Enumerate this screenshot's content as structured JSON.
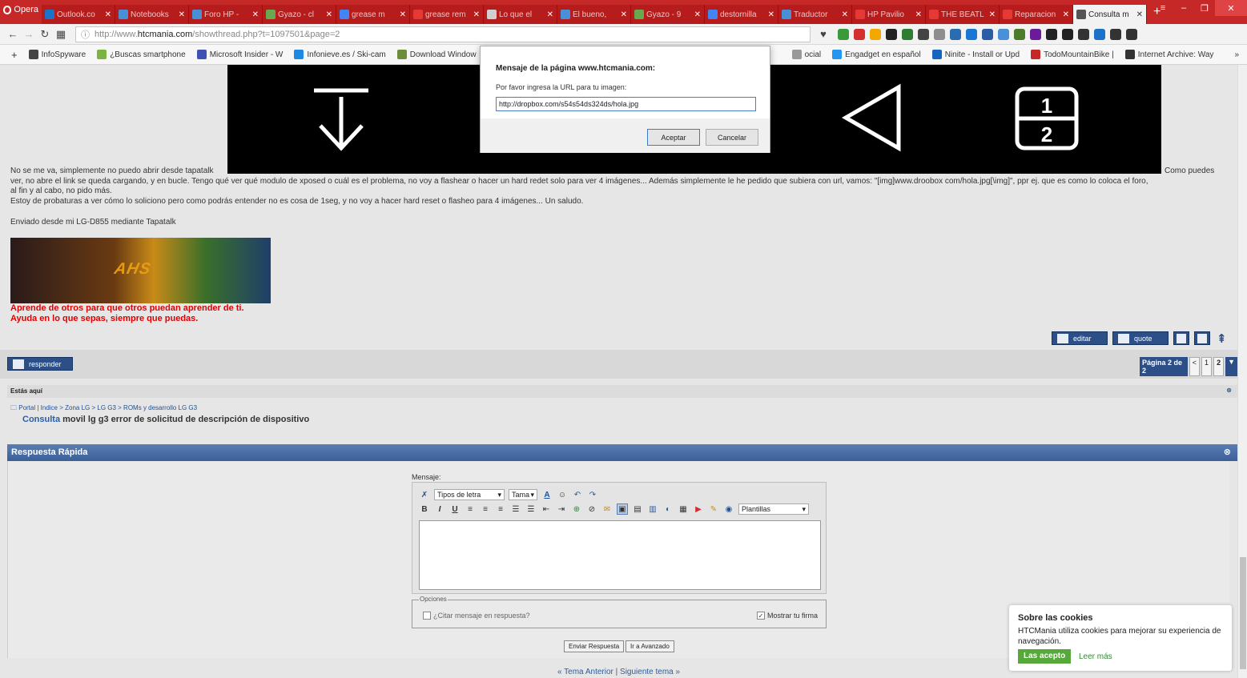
{
  "browser": {
    "opera_label": "Opera",
    "tabs": [
      {
        "label": "Outlook.co",
        "color": "#1a73c8"
      },
      {
        "label": "Notebooks",
        "color": "#4a90d9"
      },
      {
        "label": "Foro HP -",
        "color": "#4a90d9"
      },
      {
        "label": "Gyazo - cl",
        "color": "#6aa84f"
      },
      {
        "label": "grease m",
        "color": "#4285f4"
      },
      {
        "label": "grease rem",
        "color": "#e53935"
      },
      {
        "label": "Lo que el",
        "color": "#cfcfcf"
      },
      {
        "label": "El bueno,",
        "color": "#4a90d9"
      },
      {
        "label": "Gyazo - 9",
        "color": "#6aa84f"
      },
      {
        "label": "destornilla",
        "color": "#4285f4"
      },
      {
        "label": "Traductor",
        "color": "#4a90d9"
      },
      {
        "label": "HP Pavilio",
        "color": "#e53935"
      },
      {
        "label": "THE BEATL",
        "color": "#e53935"
      },
      {
        "label": "Reparacion",
        "color": "#e53935"
      },
      {
        "label": "Consulta m",
        "color": "#555555"
      }
    ],
    "url_prefix": "http://www.",
    "url_domain": "htcmania.com",
    "url_path": "/showthread.php?t=1097501&page=2",
    "bookmarks": [
      "InfoSpyware",
      "¿Buscas smartphone",
      "Microsoft Insider - W",
      "Infonieve.es / Ski-cam",
      "Download Window",
      "ocial",
      "Engadget en español",
      "Ninite - Install or Upd",
      "TodoMountainBike |",
      "Internet Archive: Way"
    ],
    "more_label": "»"
  },
  "post": {
    "line1_left": "No se me va, simplemente no puedo abrir desde tapatalk",
    "line1_right": "Como puedes",
    "line2": "ver, no abre el link se queda cargando, y en bucle. Tengo qué ver qué modulo de xposed o cuál es el problema, no voy a flashear o hacer un hard redet solo para ver 4 imágenes... Además simplemente le he pedido que subiera con url, vamos: \"[img]www.droobox com/hola.jpg[\\img]\", ppr ej. que es como lo coloca el foro,",
    "line3": "al fin y al cabo, no pido más.",
    "line4": "Estoy de probaturas a ver cómo lo soliciono pero como podrás entender no es cosa de 1seg, y no voy a hacer hard reset o flasheo para 4 imágenes... Un saludo.",
    "sent_from": "Enviado desde mi LG-D855 mediante Tapatalk",
    "sig_logo": "AHS",
    "sig_line1": "Aprende de otros para que otros puedan aprender de ti.",
    "sig_line2": "Ayuda en lo que sepas, siempre que puedas.",
    "edit_label": "editar",
    "quote_label": "quote"
  },
  "image_icons": {
    "fraction_top": "1",
    "fraction_bottom": "2"
  },
  "thread_nav": {
    "reply_label": "responder",
    "page_label": "Página 2 de 2",
    "prev": "<",
    "pages": [
      "1",
      "2"
    ]
  },
  "location": {
    "heading": "Estás aquí",
    "breadcrumb": "Portal | Indice > Zona LG > LG G3 > ROMs y desarrollo LG G3",
    "thread_prefix": "Consulta",
    "thread_title": "movil lg g3 error de solicitud de descripción de dispositivo"
  },
  "quick_reply": {
    "heading": "Respuesta Rápida",
    "message_label": "Mensaje:",
    "font_select": "Tipos de letra",
    "size_select": "Tama",
    "templates_select": "Plantillas",
    "options_legend": "Opciones",
    "quote_option": "¿Citar mensaje en respuesta?",
    "signature_option": "Mostrar tu firma",
    "submit_label": "Enviar Respuesta",
    "advanced_label": "Ir a Avanzado"
  },
  "footer": {
    "prev_thread": "« Tema Anterior",
    "separator": "|",
    "next_thread": "Siguiente tema »"
  },
  "dialog": {
    "title": "Mensaje de la página www.htcmania.com:",
    "prompt": "Por favor ingresa la URL para tu imagen:",
    "input_value": "http://dropbox.com/s54s54ds324ds/hola.jpg",
    "ok_label": "Aceptar",
    "cancel_label": "Cancelar"
  },
  "cookie": {
    "title": "Sobre las cookies",
    "body": "HTCMania utiliza cookies para mejorar su experiencia de navegación.",
    "accept_label": "Las acepto",
    "more_label": "Leer más"
  }
}
